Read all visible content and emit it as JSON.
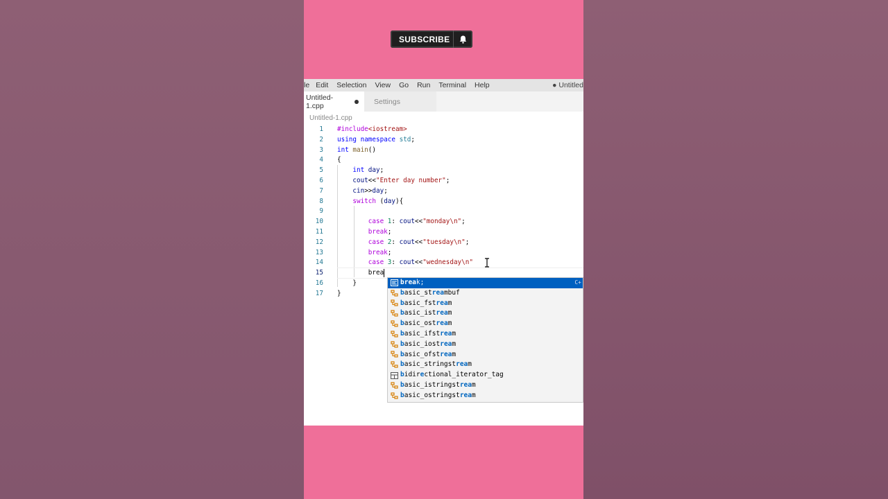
{
  "subscribe": {
    "label": "SUBSCRIBE"
  },
  "menu": {
    "items": [
      "le",
      "Edit",
      "Selection",
      "View",
      "Go",
      "Run",
      "Terminal",
      "Help"
    ],
    "title": "● Untitled"
  },
  "tabs": {
    "active": "Untitled-1.cpp",
    "inactive": "Settings"
  },
  "breadcrumb": "Untitled-1.cpp",
  "code_lines": [
    {
      "n": "1",
      "html": "<span class='ctl'>#include</span><span class='str'>&lt;iostream&gt;</span>"
    },
    {
      "n": "2",
      "html": "<span class='kw'>using</span> <span class='kw'>namespace</span> <span class='ty'>std</span>;"
    },
    {
      "n": "3",
      "html": "<span class='kw'>int</span> <span class='fn'>main</span>()"
    },
    {
      "n": "4",
      "html": "{"
    },
    {
      "n": "5",
      "html": "    <span class='kw'>int</span> <span class='var'>day</span>;"
    },
    {
      "n": "6",
      "html": "    <span class='var'>cout</span>&lt;&lt;<span class='str'>\"Enter day number\"</span>;"
    },
    {
      "n": "7",
      "html": "    <span class='var'>cin</span>&gt;&gt;<span class='var'>day</span>;"
    },
    {
      "n": "8",
      "html": "    <span class='ctl'>switch</span> (<span class='var'>day</span>){"
    },
    {
      "n": "9",
      "html": ""
    },
    {
      "n": "10",
      "html": "        <span class='ctl'>case</span> <span class='num'>1</span>: <span class='var'>cout</span>&lt;&lt;<span class='str'>\"monday\\n\"</span>;"
    },
    {
      "n": "11",
      "html": "        <span class='ctl'>break</span>;"
    },
    {
      "n": "12",
      "html": "        <span class='ctl'>case</span> <span class='num'>2</span>: <span class='var'>cout</span>&lt;&lt;<span class='str'>\"tuesday\\n\"</span>;"
    },
    {
      "n": "13",
      "html": "        <span class='ctl'>break</span>;"
    },
    {
      "n": "14",
      "html": "        <span class='ctl'>case</span> <span class='num'>3</span>: <span class='var'>cout</span>&lt;&lt;<span class='str'>\"wednesday\\n\"</span>"
    },
    {
      "n": "15",
      "html": "        brea<span class='caret'></span>"
    },
    {
      "n": "16",
      "html": "    }"
    },
    {
      "n": "17",
      "html": "}"
    }
  ],
  "suggestions": [
    {
      "match": "brea",
      "rest": "k;",
      "icon": "snippet-icon",
      "hint": "C+"
    },
    {
      "match": "b",
      "rest": "asic_st",
      "match2": "rea",
      "rest2": "mbuf",
      "icon": "class-icon"
    },
    {
      "match": "b",
      "rest": "asic_fst",
      "match2": "rea",
      "rest2": "m",
      "icon": "class-icon"
    },
    {
      "match": "b",
      "rest": "asic_ist",
      "match2": "rea",
      "rest2": "m",
      "icon": "class-icon"
    },
    {
      "match": "b",
      "rest": "asic_ost",
      "match2": "rea",
      "rest2": "m",
      "icon": "class-icon"
    },
    {
      "match": "b",
      "rest": "asic_ifst",
      "match2": "rea",
      "rest2": "m",
      "icon": "class-icon"
    },
    {
      "match": "b",
      "rest": "asic_iost",
      "match2": "rea",
      "rest2": "m",
      "icon": "class-icon"
    },
    {
      "match": "b",
      "rest": "asic_ofst",
      "match2": "rea",
      "rest2": "m",
      "icon": "class-icon"
    },
    {
      "match": "b",
      "rest": "asic_stringst",
      "match2": "rea",
      "rest2": "m",
      "icon": "class-icon"
    },
    {
      "match": "b",
      "rest": "idir",
      "match2": "e",
      "rest2": "ctional_iterator_tag",
      "icon": "struct-icon"
    },
    {
      "match": "b",
      "rest": "asic_istringst",
      "match2": "rea",
      "rest2": "m",
      "icon": "class-icon"
    },
    {
      "match": "b",
      "rest": "asic_ostringst",
      "match2": "rea",
      "rest2": "m",
      "icon": "class-icon"
    }
  ],
  "colors": {
    "phone_bg": "#ef6f99",
    "selection": "#0060c0",
    "side_bg": "#8a5a70"
  }
}
